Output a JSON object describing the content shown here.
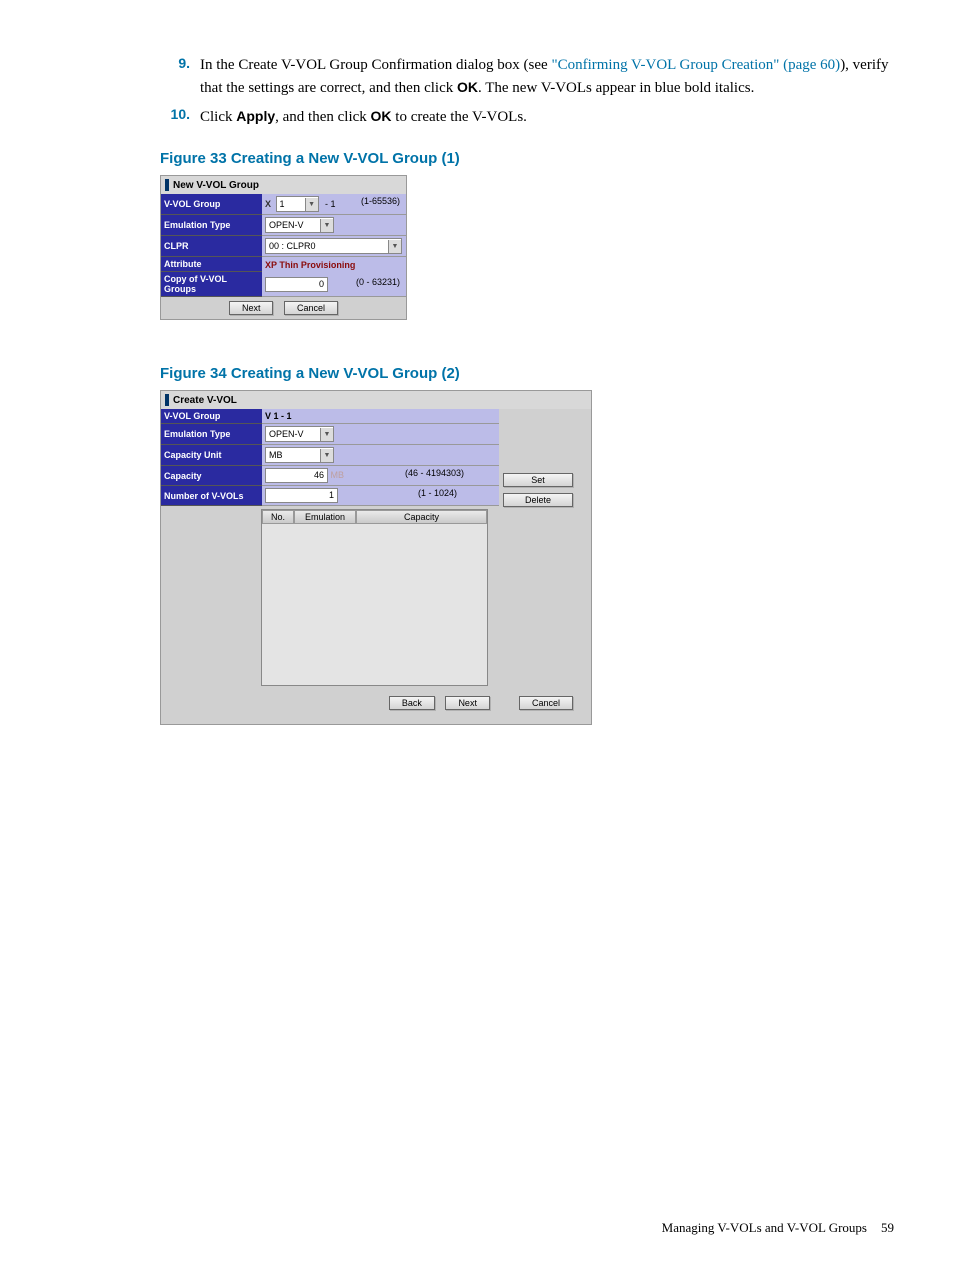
{
  "steps": {
    "s9": {
      "num": "9.",
      "pre": "In the Create V-VOL Group Confirmation dialog box (see ",
      "link": "\"Confirming V-VOL Group Creation\" (page 60)",
      "mid": "), verify that the settings are correct, and then click ",
      "bold1": "OK",
      "post": ". The new V-VOLs appear in blue bold italics."
    },
    "s10": {
      "num": "10.",
      "pre": "Click ",
      "bold1": "Apply",
      "mid": ", and then click ",
      "bold2": "OK",
      "post": " to create the V-VOLs."
    }
  },
  "fig33": {
    "caption": "Figure 33 Creating a New V-VOL Group (1)",
    "title": "New V-VOL Group",
    "rows": {
      "vvol_label": "V-VOL Group",
      "vvol_x": "X",
      "vvol_dd": "1",
      "vvol_suffix": "- 1",
      "vvol_range": "(1-65536)",
      "emu_label": "Emulation Type",
      "emu_val": "OPEN-V",
      "clpr_label": "CLPR",
      "clpr_val": "00 : CLPR0",
      "attr_label": "Attribute",
      "attr_val": "XP Thin Provisioning",
      "copy_label": "Copy of V-VOL Groups",
      "copy_val": "0",
      "copy_range": "(0 - 63231)"
    },
    "btn_next": "Next",
    "btn_cancel": "Cancel"
  },
  "fig34": {
    "caption": "Figure 34 Creating a New V-VOL Group (2)",
    "title": "Create V-VOL",
    "rows": {
      "vvol_label": "V-VOL Group",
      "vvol_val": "V 1 - 1",
      "emu_label": "Emulation Type",
      "emu_val": "OPEN-V",
      "unit_label": "Capacity Unit",
      "unit_val": "MB",
      "cap_label": "Capacity",
      "cap_val": "46",
      "cap_unit": "MB",
      "cap_range": "(46 - 4194303)",
      "num_label": "Number of V-VOLs",
      "num_val": "1",
      "num_range": "(1 - 1024)"
    },
    "cols": {
      "no": "No.",
      "em": "Emulation",
      "cap": "Capacity"
    },
    "btn_set": "Set",
    "btn_delete": "Delete",
    "btn_back": "Back",
    "btn_next": "Next",
    "btn_cancel": "Cancel"
  },
  "footer": {
    "text": "Managing V-VOLs and V-VOL Groups",
    "page": "59"
  }
}
